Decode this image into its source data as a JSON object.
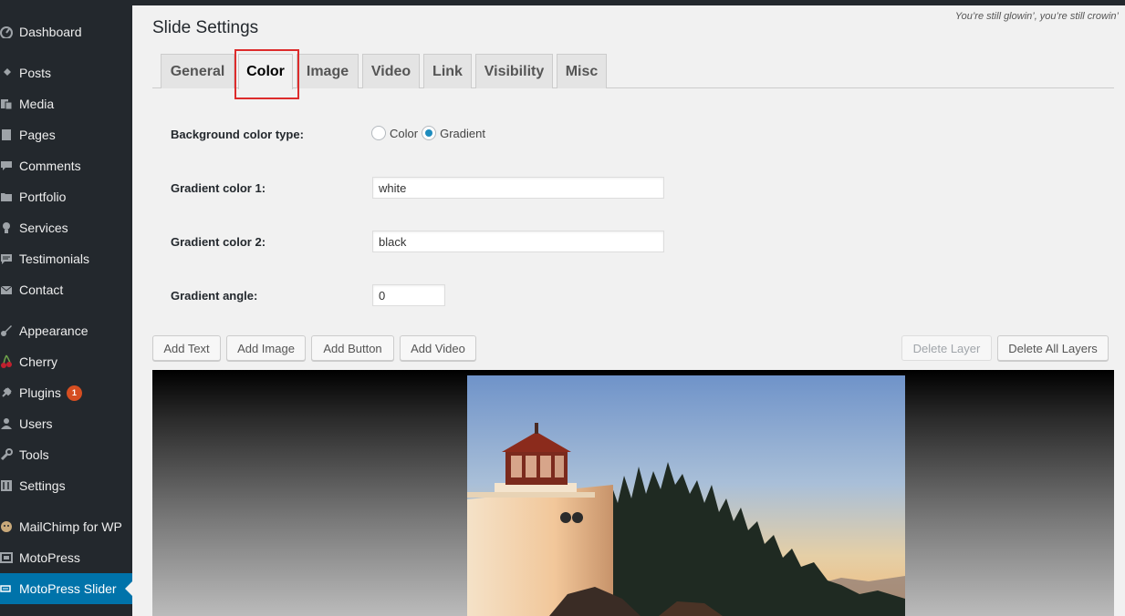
{
  "sidebar": {
    "items": [
      {
        "label": "Dashboard",
        "icon": "dashboard-icon"
      },
      {
        "label": "Posts",
        "icon": "pin-icon"
      },
      {
        "label": "Media",
        "icon": "media-icon"
      },
      {
        "label": "Pages",
        "icon": "pages-icon"
      },
      {
        "label": "Comments",
        "icon": "comments-icon"
      },
      {
        "label": "Portfolio",
        "icon": "portfolio-icon"
      },
      {
        "label": "Services",
        "icon": "lightbulb-icon"
      },
      {
        "label": "Testimonials",
        "icon": "testimonial-icon"
      },
      {
        "label": "Contact",
        "icon": "contact-icon"
      },
      {
        "label": "Appearance",
        "icon": "paintbrush-icon"
      },
      {
        "label": "Cherry",
        "icon": "cherry-icon"
      },
      {
        "label": "Plugins",
        "icon": "plugins-icon",
        "badge": "1"
      },
      {
        "label": "Users",
        "icon": "users-icon"
      },
      {
        "label": "Tools",
        "icon": "wrench-icon"
      },
      {
        "label": "Settings",
        "icon": "settings-icon"
      },
      {
        "label": "MailChimp for WP",
        "icon": "mailchimp-icon"
      },
      {
        "label": "MotoPress",
        "icon": "motopress-icon"
      },
      {
        "label": "MotoPress Slider",
        "icon": "slider-icon",
        "active": true
      }
    ]
  },
  "header": {
    "tagline": "You’re still glowin’, you’re still crowin’",
    "title": "Slide Settings"
  },
  "tabs": [
    {
      "label": "General"
    },
    {
      "label": "Color",
      "active": true
    },
    {
      "label": "Image"
    },
    {
      "label": "Video"
    },
    {
      "label": "Link"
    },
    {
      "label": "Visibility"
    },
    {
      "label": "Misc"
    }
  ],
  "form": {
    "bg_type_label": "Background color type:",
    "bg_type_options": [
      "Color",
      "Gradient"
    ],
    "bg_type_selected": "Gradient",
    "gradient1_label": "Gradient color 1:",
    "gradient1_value": "white",
    "gradient2_label": "Gradient color 2:",
    "gradient2_value": "black",
    "angle_label": "Gradient angle:",
    "angle_value": "0"
  },
  "layer_buttons": {
    "add_text": "Add Text",
    "add_image": "Add Image",
    "add_button": "Add Button",
    "add_video": "Add Video",
    "delete_layer": "Delete Layer",
    "delete_all": "Delete All Layers"
  },
  "colors": {
    "sidebar_bg": "#23282d",
    "active_bg": "#0073aa",
    "highlight": "#dd2c2c",
    "badge": "#d54e21"
  }
}
